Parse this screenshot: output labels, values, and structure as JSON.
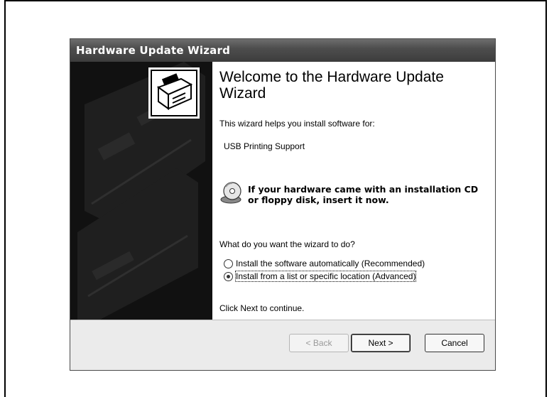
{
  "window": {
    "title": "Hardware Update Wizard"
  },
  "wizard": {
    "heading": "Welcome to the Hardware Update Wizard",
    "intro": "This wizard helps you install software for:",
    "device_name": "USB Printing Support",
    "cd_notice_line1": "If your hardware came with an installation CD",
    "cd_notice_line2": "or floppy disk, insert it now.",
    "question": "What do you want the wizard to do?",
    "options": [
      {
        "label": "Install the software automatically (Recommended)",
        "selected": false
      },
      {
        "label": "Install from a list or specific location (Advanced)",
        "selected": true
      }
    ],
    "continue_hint": "Click Next to continue."
  },
  "buttons": {
    "back": "< Back",
    "next": "Next >",
    "cancel": "Cancel"
  },
  "colors": {
    "titlebar": "#4e4e4e",
    "side_panel": "#111111",
    "footer": "#ebebeb"
  }
}
